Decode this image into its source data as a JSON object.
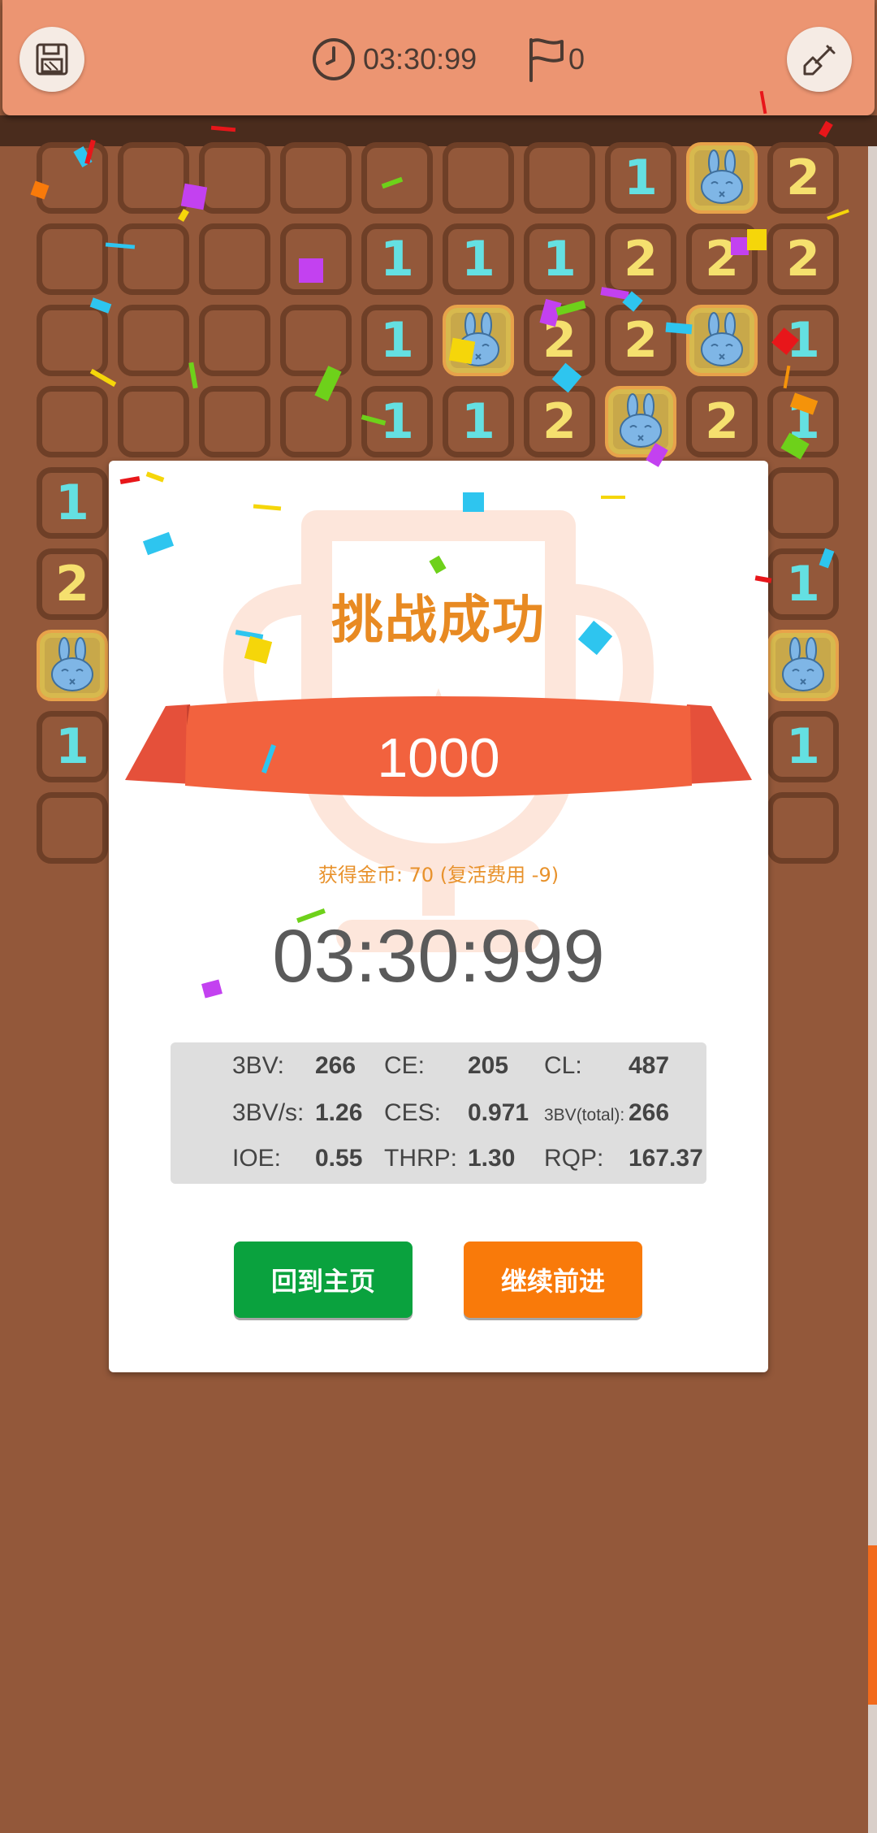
{
  "header": {
    "timer": "03:30:99",
    "flag_count": "0",
    "save_icon": "save-icon",
    "shovel_icon": "shovel-icon"
  },
  "board": {
    "rows": [
      [
        "",
        "",
        "",
        "",
        "",
        "",
        "",
        "1",
        "M",
        "2"
      ],
      [
        "",
        "",
        "",
        "",
        "1",
        "1",
        "1",
        "2",
        "2",
        "2"
      ],
      [
        "",
        "",
        "",
        "",
        "1",
        "M",
        "2",
        "2",
        "M",
        "1"
      ],
      [
        "",
        "",
        "",
        "",
        "1",
        "1",
        "2",
        "M",
        "2",
        "1"
      ],
      [
        "1",
        "",
        "",
        "",
        "",
        "",
        "",
        "",
        "",
        ""
      ],
      [
        "2",
        "",
        "",
        "",
        "",
        "",
        "",
        "",
        "",
        "1"
      ],
      [
        "M",
        "",
        "",
        "",
        "",
        "",
        "",
        "",
        "",
        "M"
      ],
      [
        "1",
        "",
        "",
        "",
        "",
        "",
        "",
        "",
        "",
        "1"
      ],
      [
        "",
        "",
        "",
        "",
        "",
        "",
        "",
        "",
        "",
        ""
      ]
    ],
    "mine_icon": "dead-bunny-icon"
  },
  "result": {
    "title": "挑战成功",
    "score": "1000",
    "coins_text": "获得金币: 70 (复活费用 -9)",
    "time": "03:30:999",
    "stats": [
      [
        {
          "label": "3BV:",
          "value": "266"
        },
        {
          "label": "CE:",
          "value": "205"
        },
        {
          "label": "CL:",
          "value": "487"
        }
      ],
      [
        {
          "label": "3BV/s:",
          "value": "1.26"
        },
        {
          "label": "CES:",
          "value": "0.971"
        },
        {
          "label": "3BV(total):",
          "value": "266"
        }
      ],
      [
        {
          "label": "IOE:",
          "value": "0.55"
        },
        {
          "label": "THRP:",
          "value": "1.30"
        },
        {
          "label": "RQP:",
          "value": "167.37"
        }
      ]
    ],
    "home_button": "回到主页",
    "continue_button": "继续前进"
  },
  "colors": {
    "board_bg": "#93583a",
    "header_bg": "#ec9572",
    "number_1": "#64e0e2",
    "number_2": "#f5e06e",
    "title": "#e88a22",
    "ribbon": "#f2623e",
    "home_button": "#0aa23e",
    "continue_button": "#f97a0a"
  }
}
